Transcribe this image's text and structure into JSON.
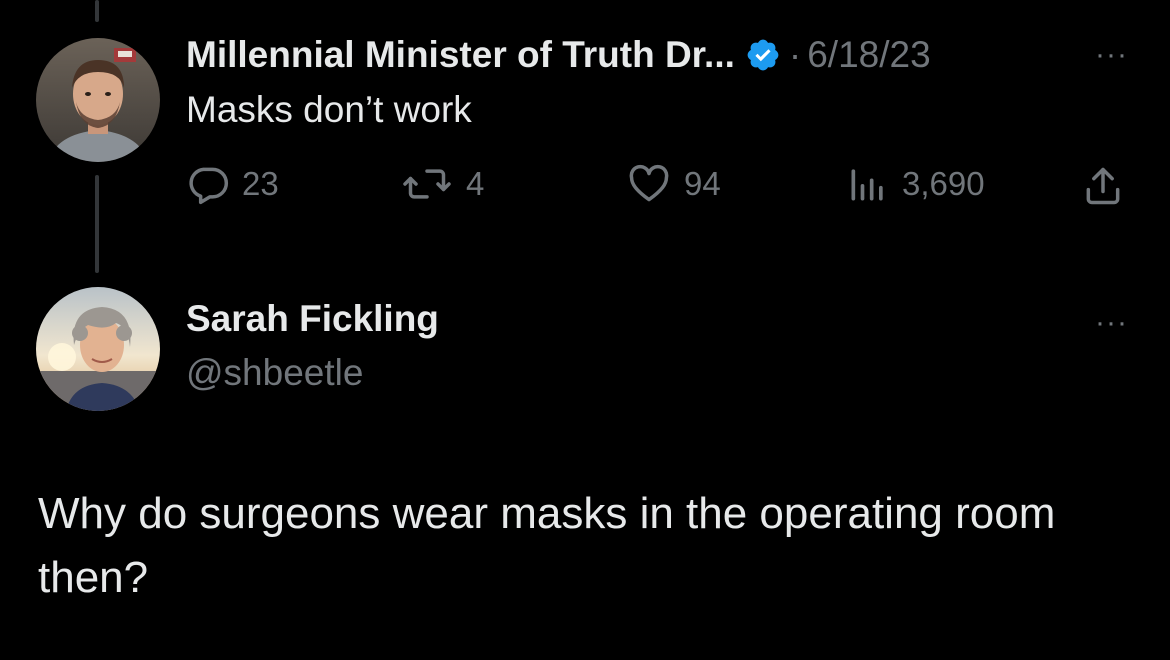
{
  "original_tweet": {
    "display_name": "Millennial Minister of Truth Dr...",
    "verified": true,
    "separator": "·",
    "date": "6/18/23",
    "text": "Masks don’t work",
    "more_label": "···",
    "actions": {
      "replies": "23",
      "retweets": "4",
      "likes": "94",
      "views": "3,690"
    }
  },
  "reply_tweet": {
    "display_name": "Sarah Fickling",
    "handle": "@shbeetle",
    "more_label": "···",
    "text": "Why do surgeons wear masks in the operating room then?"
  },
  "icons": {
    "reply": "reply-bubble-icon",
    "retweet": "retweet-icon",
    "like": "heart-icon",
    "views": "views-bar-chart-icon",
    "share": "share-upload-icon",
    "verified": "verified-badge-icon"
  },
  "colors": {
    "background": "#000000",
    "primary_text": "#e7e9ea",
    "secondary_text": "#71767b",
    "verified_blue": "#1d9bf0",
    "thread_line": "#333639"
  }
}
